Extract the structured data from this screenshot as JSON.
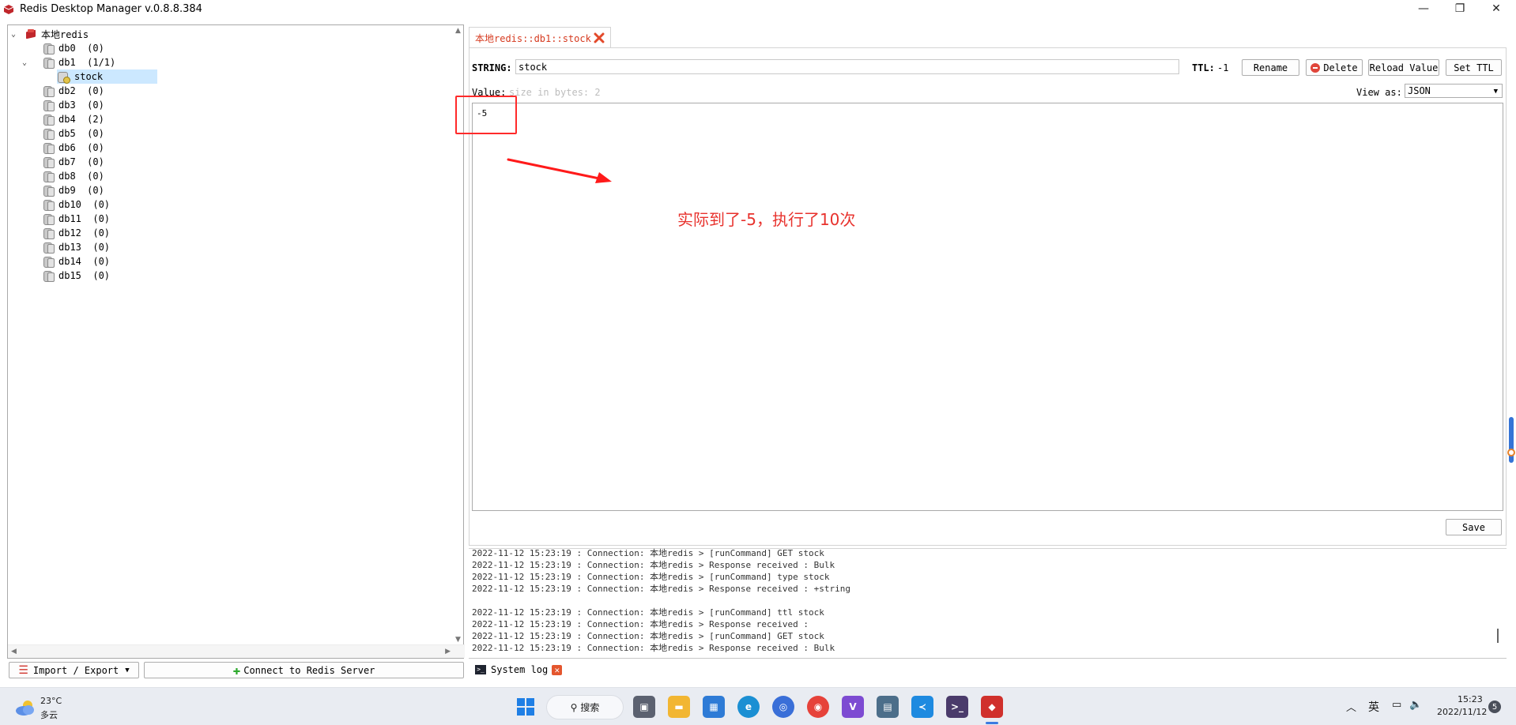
{
  "window": {
    "title": "Redis Desktop Manager v.0.8.8.384",
    "minimize": "—",
    "restore": "❐",
    "close": "✕"
  },
  "tree": {
    "server": "本地redis",
    "dbs": [
      {
        "label": "db0  (0)"
      },
      {
        "label": "db1  (1/1)"
      },
      {
        "label": "db2  (0)"
      },
      {
        "label": "db3  (0)"
      },
      {
        "label": "db4  (2)"
      },
      {
        "label": "db5  (0)"
      },
      {
        "label": "db6  (0)"
      },
      {
        "label": "db7  (0)"
      },
      {
        "label": "db8  (0)"
      },
      {
        "label": "db9  (0)"
      },
      {
        "label": "db10  (0)"
      },
      {
        "label": "db11  (0)"
      },
      {
        "label": "db12  (0)"
      },
      {
        "label": "db13  (0)"
      },
      {
        "label": "db14  (0)"
      },
      {
        "label": "db15  (0)"
      }
    ],
    "key": "stock"
  },
  "left_buttons": {
    "import_export": "Import / Export",
    "connect": "Connect to Redis Server"
  },
  "tab": {
    "title": "本地redis::db1::stock"
  },
  "key_editor": {
    "type_label": "STRING:",
    "key_name": "stock",
    "ttl_label": "TTL:",
    "ttl_value": "-1",
    "rename": "Rename",
    "delete": "Delete",
    "reload": "Reload Value",
    "set_ttl": "Set TTL",
    "value_label": "Value:",
    "size_hint": "size in bytes: 2",
    "view_as_label": "View as:",
    "view_as_value": "JSON",
    "value": "-5",
    "save": "Save"
  },
  "annotation": {
    "text": "实际到了-5，执行了10次"
  },
  "log": {
    "lines": [
      "2022-11-12 15:23:19 : Connection: 本地redis > [runCommand] GET stock",
      "2022-11-12 15:23:19 : Connection: 本地redis > Response received : Bulk",
      "2022-11-12 15:23:19 : Connection: 本地redis > [runCommand] type stock",
      "2022-11-12 15:23:19 : Connection: 本地redis > Response received : +string",
      "",
      "2022-11-12 15:23:19 : Connection: 本地redis > [runCommand] ttl stock",
      "2022-11-12 15:23:19 : Connection: 本地redis > Response received :",
      "2022-11-12 15:23:19 : Connection: 本地redis > [runCommand] GET stock",
      "2022-11-12 15:23:19 : Connection: 本地redis > Response received : Bulk"
    ],
    "tab_label": "System log"
  },
  "taskbar": {
    "weather_temp": "23°C",
    "weather_desc": "多云",
    "search": "搜索",
    "ime": "英",
    "time": "15:23",
    "date": "2022/11/12",
    "notifications": "5"
  },
  "colors": {
    "accent_red": "#e8322d",
    "selection": "#cce8ff",
    "tab_text": "#d63a1f"
  }
}
